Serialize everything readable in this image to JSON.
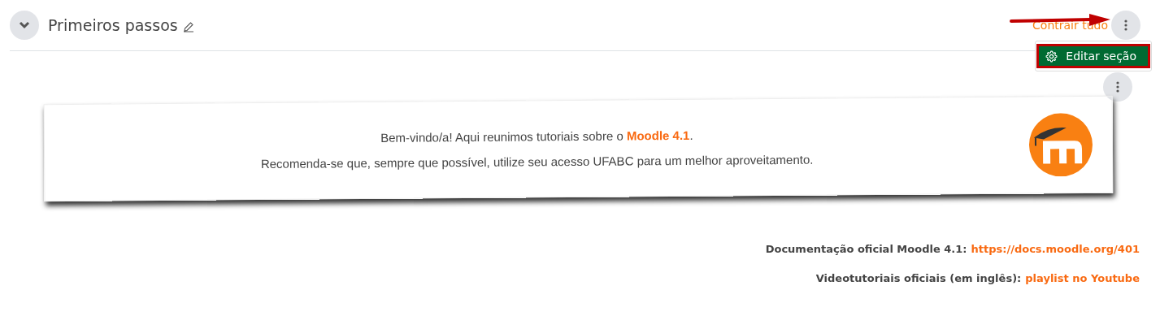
{
  "section": {
    "title": "Primeiros passos",
    "expanded": true,
    "collapse_all": "Contrair tudo"
  },
  "menu": {
    "items": [
      {
        "label": "Editar seção",
        "highlighted": true
      }
    ]
  },
  "card": {
    "intro_before": "Bem-vindo/a! Aqui reunimos tutoriais sobre o ",
    "intro_link": "Moodle 4.1",
    "intro_after": ".",
    "note": "Recomenda-se que, sempre que possível, utilize seu acesso UFABC para um melhor aproveitamento."
  },
  "links": [
    {
      "label": "Documentação oficial Moodle 4.1:",
      "link": "https://docs.moodle.org/401"
    },
    {
      "label": "Videotutoriais oficiais (em inglês):",
      "link": "playlist no Youtube"
    }
  ]
}
